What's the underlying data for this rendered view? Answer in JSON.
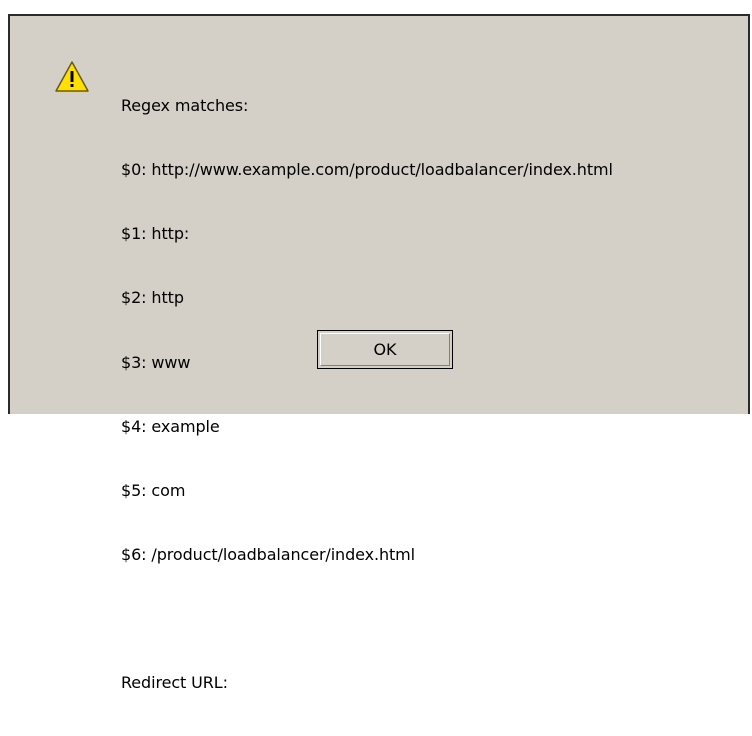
{
  "dialog": {
    "icon": "warning-icon",
    "lines": [
      "Regex matches:",
      "$0: http://www.example.com/product/loadbalancer/index.html",
      "$1: http:",
      "$2: http",
      "$3: www",
      "$4: example",
      "$5: com",
      "$6: /product/loadbalancer/index.html"
    ],
    "redirect_label": "Redirect URL:",
    "ok_label": "OK"
  },
  "colors": {
    "dialog_bg": "#d4d0c8",
    "warning_yellow": "#ffe000",
    "border": "#2b2b2b"
  }
}
